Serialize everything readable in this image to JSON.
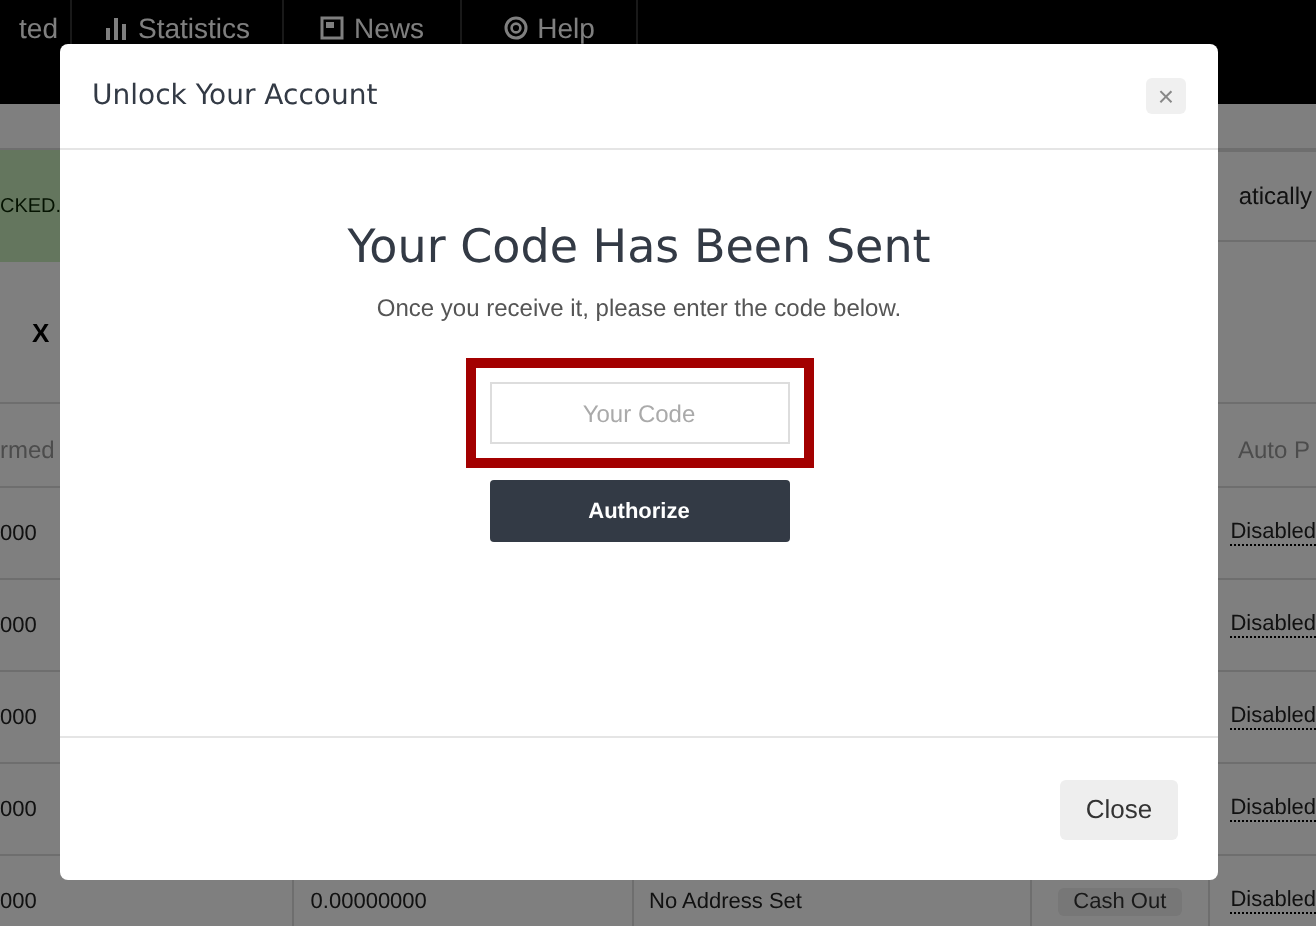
{
  "nav": {
    "items": [
      {
        "label": "ted"
      },
      {
        "label": "Statistics"
      },
      {
        "label": "News"
      },
      {
        "label": "Help"
      }
    ]
  },
  "alert": {
    "text": "CKED."
  },
  "panel": {
    "text": "atically"
  },
  "toggle": {
    "text": "X"
  },
  "table": {
    "columns": [
      "rmed",
      "Auto P"
    ],
    "rows": [
      {
        "column_1": "000",
        "auto_pay": "Disabled"
      },
      {
        "column_1": "000",
        "auto_pay": "Disabled"
      },
      {
        "column_1": "000",
        "auto_pay": "Disabled"
      },
      {
        "column_1": "000",
        "auto_pay": "Disabled"
      },
      {
        "column_1": "000",
        "column_2": "0.00000000",
        "column_3": "No Address Set",
        "action": "Cash Out",
        "auto_pay": "Disabled"
      }
    ]
  },
  "modal": {
    "title": "Unlock Your Account",
    "close_icon": "×",
    "heading": "Your Code Has Been Sent",
    "message": "Once you receive it, please enter the code below.",
    "code_field": {
      "placeholder": "Your Code",
      "highlighted": true
    },
    "authorize_button": "Authorize",
    "close_button": "Close"
  }
}
